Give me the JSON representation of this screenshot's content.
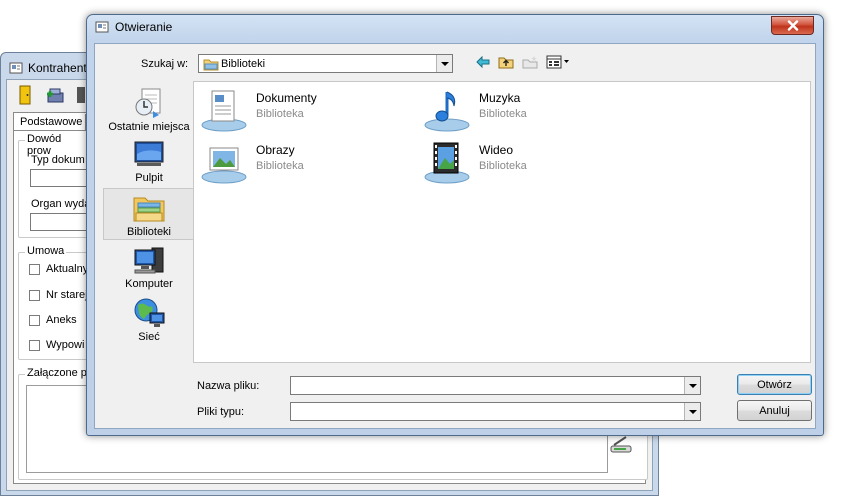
{
  "background_window": {
    "title": "Kontrahent",
    "tab_label": "Podstawowe",
    "group_dowod": "Dowód prow",
    "typ_label": "Typ dokum",
    "organ_label": "Organ wyda",
    "group_umowa": "Umowa",
    "checkboxes": [
      "Aktualny",
      "Nr starej",
      "Aneks",
      "Wypowi"
    ],
    "group_zalaczone": "Załączone p"
  },
  "dialog": {
    "title": "Otwieranie",
    "look_in_label": "Szukaj w:",
    "look_in_value": "Biblioteki",
    "places": [
      {
        "label": "Ostatnie miejsca",
        "icon": "recent-places-icon"
      },
      {
        "label": "Pulpit",
        "icon": "desktop-icon"
      },
      {
        "label": "Biblioteki",
        "icon": "libraries-icon"
      },
      {
        "label": "Komputer",
        "icon": "computer-icon"
      },
      {
        "label": "Sieć",
        "icon": "network-icon"
      }
    ],
    "files": [
      {
        "name": "Dokumenty",
        "sub": "Biblioteka",
        "icon": "documents-library-icon"
      },
      {
        "name": "Muzyka",
        "sub": "Biblioteka",
        "icon": "music-library-icon"
      },
      {
        "name": "Obrazy",
        "sub": "Biblioteka",
        "icon": "pictures-library-icon"
      },
      {
        "name": "Wideo",
        "sub": "Biblioteka",
        "icon": "video-library-icon"
      }
    ],
    "filename_label": "Nazwa pliku:",
    "filename_value": "",
    "filetype_label": "Pliki typu:",
    "filetype_value": "",
    "open_button": "Otwórz",
    "cancel_button": "Anuluj"
  },
  "colors": {
    "title_bar": "#c4d6ec",
    "close_button": "#c0331c",
    "selected_place": "#e6e6e6"
  }
}
